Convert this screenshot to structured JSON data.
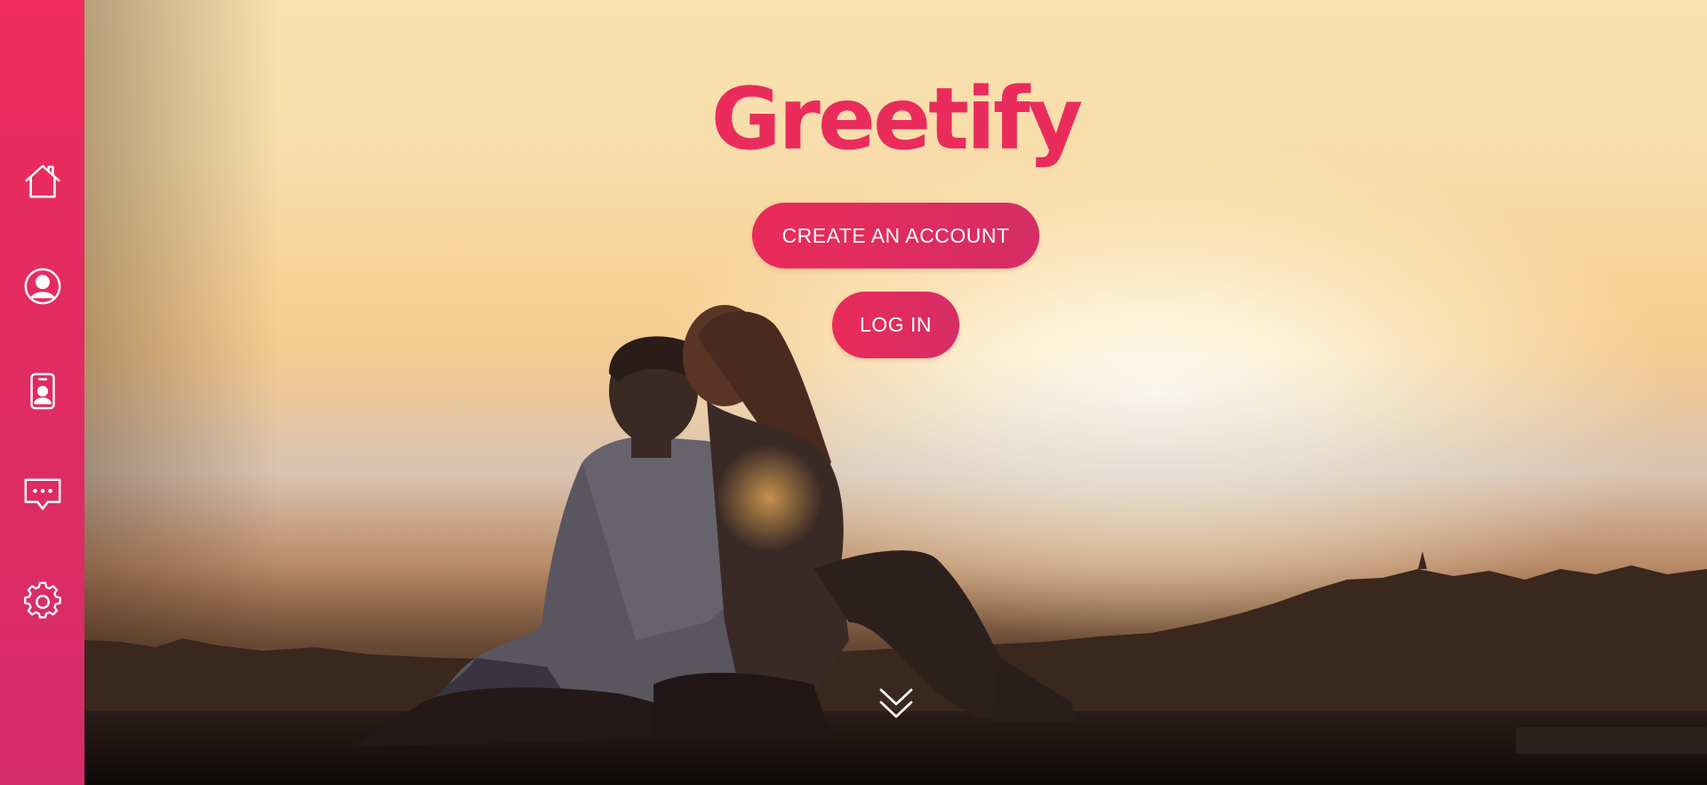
{
  "brand": {
    "name": "Greetify",
    "color": "#ea2c5d"
  },
  "sidebar": {
    "background": "#e72c60",
    "items": [
      {
        "id": "home",
        "icon": "home-icon"
      },
      {
        "id": "profile",
        "icon": "user-circle-icon"
      },
      {
        "id": "contacts",
        "icon": "id-badge-icon"
      },
      {
        "id": "messages",
        "icon": "chat-bubble-icon"
      },
      {
        "id": "settings",
        "icon": "gear-icon"
      }
    ]
  },
  "hero": {
    "actions": {
      "create_account_label": "CREATE AN ACCOUNT",
      "login_label": "LOG IN"
    },
    "scroll_icon": "double-chevron-down-icon",
    "button_color": "#e32b5c"
  }
}
